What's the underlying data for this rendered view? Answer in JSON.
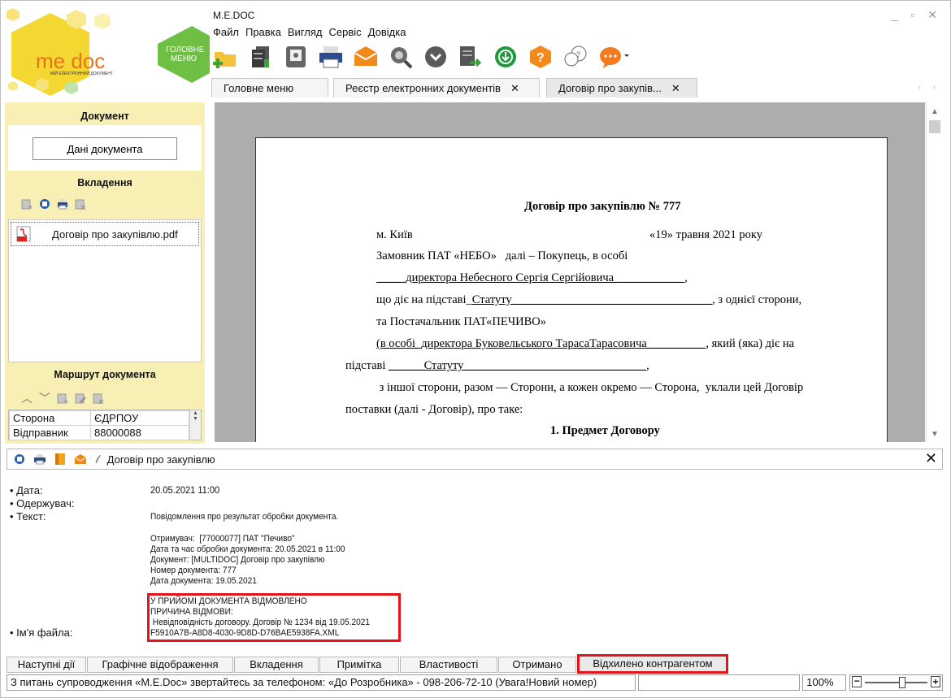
{
  "logo": {
    "brand": "me doc",
    "tagline": "МІЙ ЕЛЕКТРОННИЙ ДОКУМЕНТ",
    "home_label_1": "ГОЛОВНЕ",
    "home_label_2": "МЕНЮ"
  },
  "window": {
    "title": "M.E.DOC",
    "controls": "_ ▫ ✕"
  },
  "menu": [
    "Файл",
    "Правка",
    "Вигляд",
    "Сервіс",
    "Довідка"
  ],
  "tabs": [
    {
      "label": "Головне меню",
      "close": ""
    },
    {
      "label": "Реєстр електронних документів",
      "close": "✕"
    },
    {
      "label": "Договір про закупів...",
      "close": "✕"
    }
  ],
  "tab_arrows": "‹ ›",
  "sidebar": {
    "document_title": "Документ",
    "data_button": "Дані документа",
    "attachments_title": "Вкладення",
    "attachment_file": "Договір про закупівлю.pdf",
    "route_title": "Маршрут документа",
    "route_table": {
      "headers": [
        "Сторона",
        "ЄДРПОУ"
      ],
      "rows": [
        [
          "Відправник",
          "88000088"
        ]
      ]
    }
  },
  "paper": {
    "title": "Договір про закупівлю № 777",
    "city": "м. Київ",
    "date": "«19» травня 2021 року",
    "l1": "Замовник ПАТ «НЕБО»   далі – Покупець, в особі",
    "l2": "_____директора Небесного Сергія Сергійовича____________",
    "l2b": ",",
    "l3a": "що діє на підставі_",
    "l3b": "Статуту__________________________________",
    "l3c": ", з однієї сторони,",
    "l4": "та Постачальник ПАТ«ПЕЧИВО»",
    "l5a": "(в особі_директора Буковельського ТарасаТарасовича__________",
    "l5b": ", який (яка) діє на",
    "l6a": "підставі ",
    "l6b": "______Статуту_______________________________",
    "l6c": ",",
    "l7": " з іншої сторони, разом — Сторони, а кожен окремо — Сторона,  уклали цей Договір",
    "l8": "поставки (далі - Договір), про таке:",
    "section1": "1. Предмет Договору"
  },
  "bottom_panel": {
    "header": "Договір про закупівлю",
    "close": "✕",
    "labels": {
      "date": "• Дата:",
      "recipient": "• Одержувач:",
      "text": "• Текст:",
      "filename": "• Ім'я файла:"
    },
    "date_value": "20.05.2021 11:00",
    "text_value": "Повідомлення про результат обробки документа.",
    "details": "Отримувач:  [77000077] ПАТ \"Печиво\"\nДата та час обробки документа: 20.05.2021 в 11:00\nДокумент: [MULTIDOC] Договір про закупівлю\nНомер документа: 777\nДата документа: 19.05.2021",
    "rejection": "У ПРИЙОМІ ДОКУМЕНТА ВІДМОВЛЕНО\nПРИЧИНА ВІДМОВИ:\n Невідповідність договору. Договір № 1234 від 19.05.2021",
    "filename_value": "F5910A7B-A8D8-4030-9D8D-D76BAE5938FA.XML"
  },
  "bottom_tabs": [
    "Наступні дії",
    "Графічне відображення",
    "Вкладення",
    "Примітка",
    "Властивості",
    "Отримано",
    "Відхилено контрагентом"
  ],
  "status": {
    "message": "З питань супроводження «M.E.Doc» звертайтесь за телефоном: «До Розробника» - 098-206-72-10 (Увага!Новий номер)",
    "zoom": "100%",
    "minus": "−",
    "plus": "+",
    "zoom_level": 0.6
  },
  "colors": {
    "accent_yellow": "#f5d731",
    "hex_green": "#6fbf44",
    "sidebar_bg": "#f7efb3",
    "red_highlight": "#e4141b",
    "orange": "#f47b20"
  }
}
